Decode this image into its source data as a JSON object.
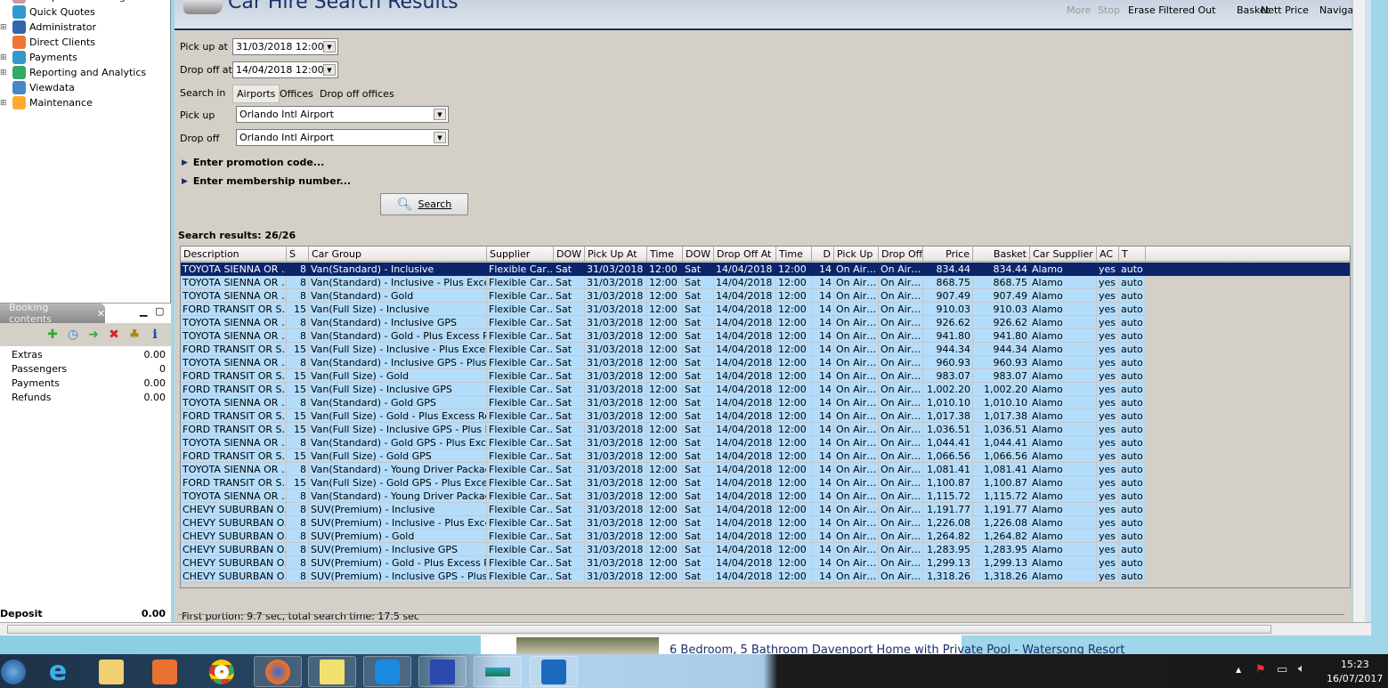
{
  "sidebar": {
    "items": [
      {
        "label": "Completed Bookings"
      },
      {
        "label": "Quick Quotes"
      },
      {
        "label": "Administrator"
      },
      {
        "label": "Direct Clients"
      },
      {
        "label": "Payments"
      },
      {
        "label": "Reporting and Analytics"
      },
      {
        "label": "Viewdata"
      },
      {
        "label": "Maintenance"
      }
    ]
  },
  "booking": {
    "tab": "Booking contents",
    "rows": [
      {
        "label": "Extras",
        "value": "0.00"
      },
      {
        "label": "Passengers",
        "value": "0"
      },
      {
        "label": "Payments",
        "value": "0.00"
      },
      {
        "label": "Refunds",
        "value": "0.00"
      }
    ],
    "deposit_label": "Deposit",
    "deposit_value": "0.00"
  },
  "header": {
    "title": "Car Hire Search Results",
    "buttons": [
      "More",
      "Stop",
      "Erase Filtered Out",
      "Basket",
      "Nett Price",
      "Navigal"
    ]
  },
  "form": {
    "pickup_at_label": "Pick up at",
    "pickup_at": "31/03/2018 12:00",
    "dropoff_at_label": "Drop off at",
    "dropoff_at": "14/04/2018 12:00",
    "search_in_label": "Search in",
    "search_in_options": [
      "Airports",
      "Offices",
      "Drop off offices"
    ],
    "pickup_label": "Pick up",
    "pickup": "Orlando Intl Airport",
    "dropoff_label": "Drop off",
    "dropoff": "Orlando Intl Airport",
    "promo": "Enter promotion code...",
    "membership": "Enter membership number...",
    "search_button": "Search"
  },
  "results": {
    "summary": "Search results: 26/26",
    "footer": "First portion: 9.7 sec, total search time: 17.5 sec",
    "columns": [
      "Description",
      "S",
      "Car Group",
      "Supplier",
      "DOW",
      "Pick Up At",
      "Time",
      "DOW",
      "Drop Off At",
      "Time",
      "D",
      "Pick Up",
      "Drop Off",
      "Price",
      "Basket",
      "Car Supplier",
      "AC",
      "T"
    ],
    "common": {
      "supplier": "Flexible Car…",
      "dow1": "Sat",
      "pickup_at": "31/03/2018",
      "time1": "12:00",
      "dow2": "Sat",
      "dropoff_at": "14/04/2018",
      "time2": "12:00",
      "days": "14",
      "pickup": "On Air…",
      "dropoff": "On Air…",
      "car_supplier": "Alamo",
      "ac": "yes",
      "t": "auto"
    },
    "rows": [
      [
        "TOYOTA SIENNA OR …",
        "8",
        "Van(Standard) - Inclusive",
        "834.44"
      ],
      [
        "TOYOTA SIENNA OR …",
        "8",
        "Van(Standard) - Inclusive - Plus Exces…",
        "868.75"
      ],
      [
        "TOYOTA SIENNA OR …",
        "8",
        "Van(Standard) - Gold",
        "907.49"
      ],
      [
        "FORD TRANSIT OR S…",
        "15",
        "Van(Full Size) - Inclusive",
        "910.03"
      ],
      [
        "TOYOTA SIENNA OR …",
        "8",
        "Van(Standard) - Inclusive GPS",
        "926.62"
      ],
      [
        "TOYOTA SIENNA OR …",
        "8",
        "Van(Standard) - Gold - Plus Excess Re…",
        "941.80"
      ],
      [
        "FORD TRANSIT OR S…",
        "15",
        "Van(Full Size) - Inclusive - Plus Excess…",
        "944.34"
      ],
      [
        "TOYOTA SIENNA OR …",
        "8",
        "Van(Standard) - Inclusive GPS - Plus E…",
        "960.93"
      ],
      [
        "FORD TRANSIT OR S…",
        "15",
        "Van(Full Size) - Gold",
        "983.07"
      ],
      [
        "FORD TRANSIT OR S…",
        "15",
        "Van(Full Size) - Inclusive GPS",
        "1,002.20"
      ],
      [
        "TOYOTA SIENNA OR …",
        "8",
        "Van(Standard) - Gold GPS",
        "1,010.10"
      ],
      [
        "FORD TRANSIT OR S…",
        "15",
        "Van(Full Size) - Gold - Plus Excess Ref…",
        "1,017.38"
      ],
      [
        "FORD TRANSIT OR S…",
        "15",
        "Van(Full Size) - Inclusive GPS - Plus Ex…",
        "1,036.51"
      ],
      [
        "TOYOTA SIENNA OR …",
        "8",
        "Van(Standard) - Gold GPS - Plus Exce…",
        "1,044.41"
      ],
      [
        "FORD TRANSIT OR S…",
        "15",
        "Van(Full Size) - Gold GPS",
        "1,066.56"
      ],
      [
        "TOYOTA SIENNA OR …",
        "8",
        "Van(Standard) - Young Driver Packag…",
        "1,081.41"
      ],
      [
        "FORD TRANSIT OR S…",
        "15",
        "Van(Full Size) - Gold GPS - Plus Excess…",
        "1,100.87"
      ],
      [
        "TOYOTA SIENNA OR …",
        "8",
        "Van(Standard) - Young Driver Packag…",
        "1,115.72"
      ],
      [
        "CHEVY SUBURBAN O…",
        "8",
        "SUV(Premium) - Inclusive",
        "1,191.77"
      ],
      [
        "CHEVY SUBURBAN O…",
        "8",
        "SUV(Premium) - Inclusive - Plus Exces…",
        "1,226.08"
      ],
      [
        "CHEVY SUBURBAN O…",
        "8",
        "SUV(Premium) - Gold",
        "1,264.82"
      ],
      [
        "CHEVY SUBURBAN O…",
        "8",
        "SUV(Premium) - Inclusive GPS",
        "1,283.95"
      ],
      [
        "CHEVY SUBURBAN O…",
        "8",
        "SUV(Premium) - Gold - Plus Excess Re…",
        "1,299.13"
      ],
      [
        "CHEVY SUBURBAN O…",
        "8",
        "SUV(Premium) - Inclusive GPS - Plus E…",
        "1,318.26"
      ]
    ]
  },
  "browser": {
    "page_title": "6 Bedroom, 5 Bathroom Davenport Home with Private Pool - Watersong Resort"
  },
  "tray": {
    "time": "15:23",
    "date": "16/07/2017"
  },
  "colors": {
    "selection": "#0b246a",
    "row": "#b4ddfc",
    "title": "#1c2e6a"
  }
}
